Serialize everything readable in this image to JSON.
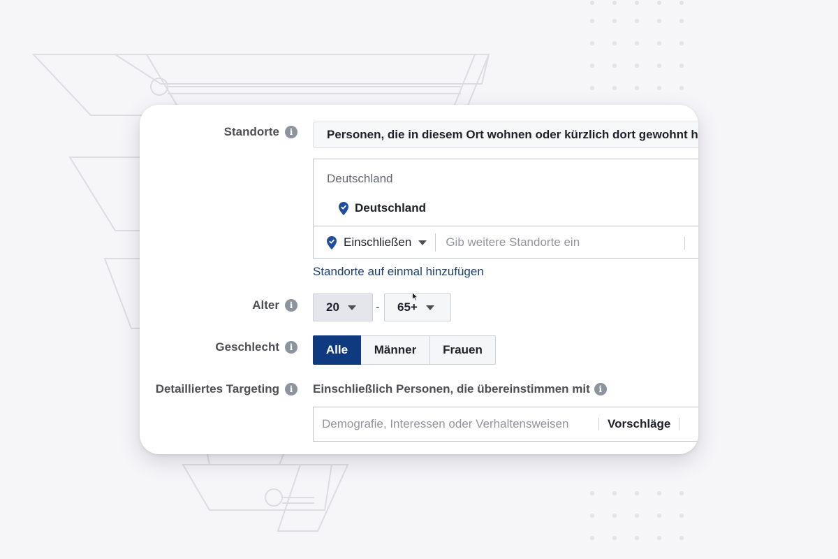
{
  "colors": {
    "background": "#f6f5f8",
    "card": "#ffffff",
    "primary_selected": "#0f3a80",
    "link": "#1d3f6e",
    "label_text": "#4b4f56",
    "pin": "#1f4e9c"
  },
  "locations": {
    "label": "Standorte",
    "info_icon": "info-icon",
    "type_value": "Personen, die in diesem Ort wohnen oder kürzlich dort gewohnt haben",
    "group_header": "Deutschland",
    "selected_item": "Deutschland",
    "pin_icon": "location-pin-icon",
    "include_label": "Einschließen",
    "input_placeholder": "Gib weitere Standorte ein",
    "bulk_link": "Standorte auf einmal hinzufügen"
  },
  "age": {
    "label": "Alter",
    "min_value": "20",
    "separator": "-",
    "max_value": "65+"
  },
  "gender": {
    "label": "Geschlecht",
    "options": [
      "Alle",
      "Männer",
      "Frauen"
    ],
    "selected": "Alle"
  },
  "targeting": {
    "label": "Detailliertes Targeting",
    "sublabel": "Einschließlich Personen, die übereinstimmen mit",
    "input_placeholder": "Demografie, Interessen oder Verhaltensweisen",
    "suggestions_label": "Vorschläge"
  }
}
